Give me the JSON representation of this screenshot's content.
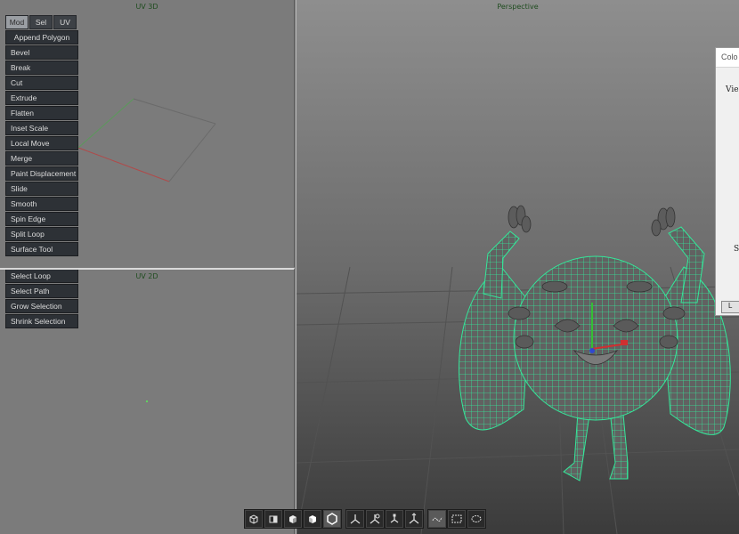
{
  "viewports": {
    "uv3d_title": "UV 3D",
    "uv2d_title": "UV 2D",
    "perspective_title": "Perspective"
  },
  "tabs": [
    {
      "label": "Mod",
      "active": true
    },
    {
      "label": "Sel",
      "active": false
    },
    {
      "label": "UV",
      "active": false
    }
  ],
  "mod_tools": [
    "Append Polygon",
    "Bevel",
    "Break",
    "Cut",
    "Extrude",
    "Flatten",
    "Inset Scale",
    "Local Move",
    "Merge",
    "Paint Displacement",
    "Slide",
    "Smooth",
    "Spin Edge",
    "Split Loop",
    "Surface Tool"
  ],
  "sel_tools": [
    "Select Loop",
    "Select Path",
    "Grow Selection",
    "Shrink Selection"
  ],
  "toolbar": {
    "shading": [
      "box-wire-icon",
      "box-half-icon",
      "box-shaded-icon",
      "box-lit-icon",
      "hexagon-icon"
    ],
    "gizmos": [
      "axis-icon",
      "axis-rotate-icon",
      "axis-scale-icon",
      "axis-universal-icon"
    ],
    "selection": [
      "lasso-icon",
      "rect-select-icon",
      "paint-select-icon"
    ]
  },
  "dialog": {
    "title": "Colo",
    "label1": "Vie",
    "label2": "S",
    "button": "L"
  },
  "colors": {
    "wire": "#34e89a",
    "panel": "#2d3136",
    "viewport_bg": "#7b7b7b"
  }
}
